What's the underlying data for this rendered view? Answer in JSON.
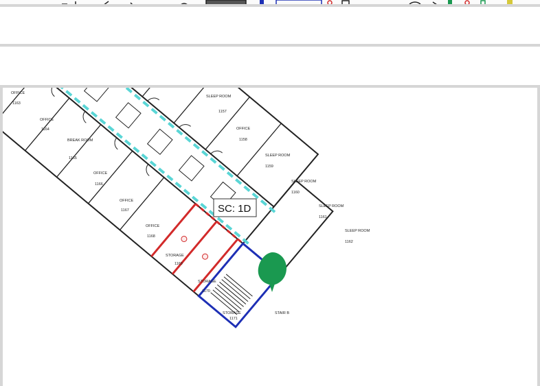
{
  "floor_plan": {
    "section_label": "SC: 1D",
    "marker_color": "#1a9950",
    "corridor_color": "#5ad6d6",
    "storage_color": "#d22a2a",
    "stair_color": "#1d2fb5",
    "rooms": [
      {
        "name": "OFFICE",
        "number": "1163"
      },
      {
        "name": "OFFICE",
        "number": "1164"
      },
      {
        "name": "BREAK ROOM",
        "number": "1165"
      },
      {
        "name": "OFFICE",
        "number": "1166"
      },
      {
        "name": "OFFICE",
        "number": "1167"
      },
      {
        "name": "OFFICE",
        "number": "1168"
      },
      {
        "name": "STORAGE",
        "number": "1169"
      },
      {
        "name": "STORAGE",
        "number": "1170"
      },
      {
        "name": "STORAGE",
        "number": "1171"
      },
      {
        "name": "SLEEP ROOM",
        "number": "1157"
      },
      {
        "name": "OFFICE",
        "number": "1158"
      },
      {
        "name": "SLEEP ROOM",
        "number": "1159"
      },
      {
        "name": "SLEEP ROOM",
        "number": "1160"
      },
      {
        "name": "SLEEP ROOM",
        "number": "1161"
      },
      {
        "name": "SLEEP ROOM",
        "number": "1162"
      },
      {
        "name": "STAIR B",
        "number": ""
      }
    ]
  }
}
